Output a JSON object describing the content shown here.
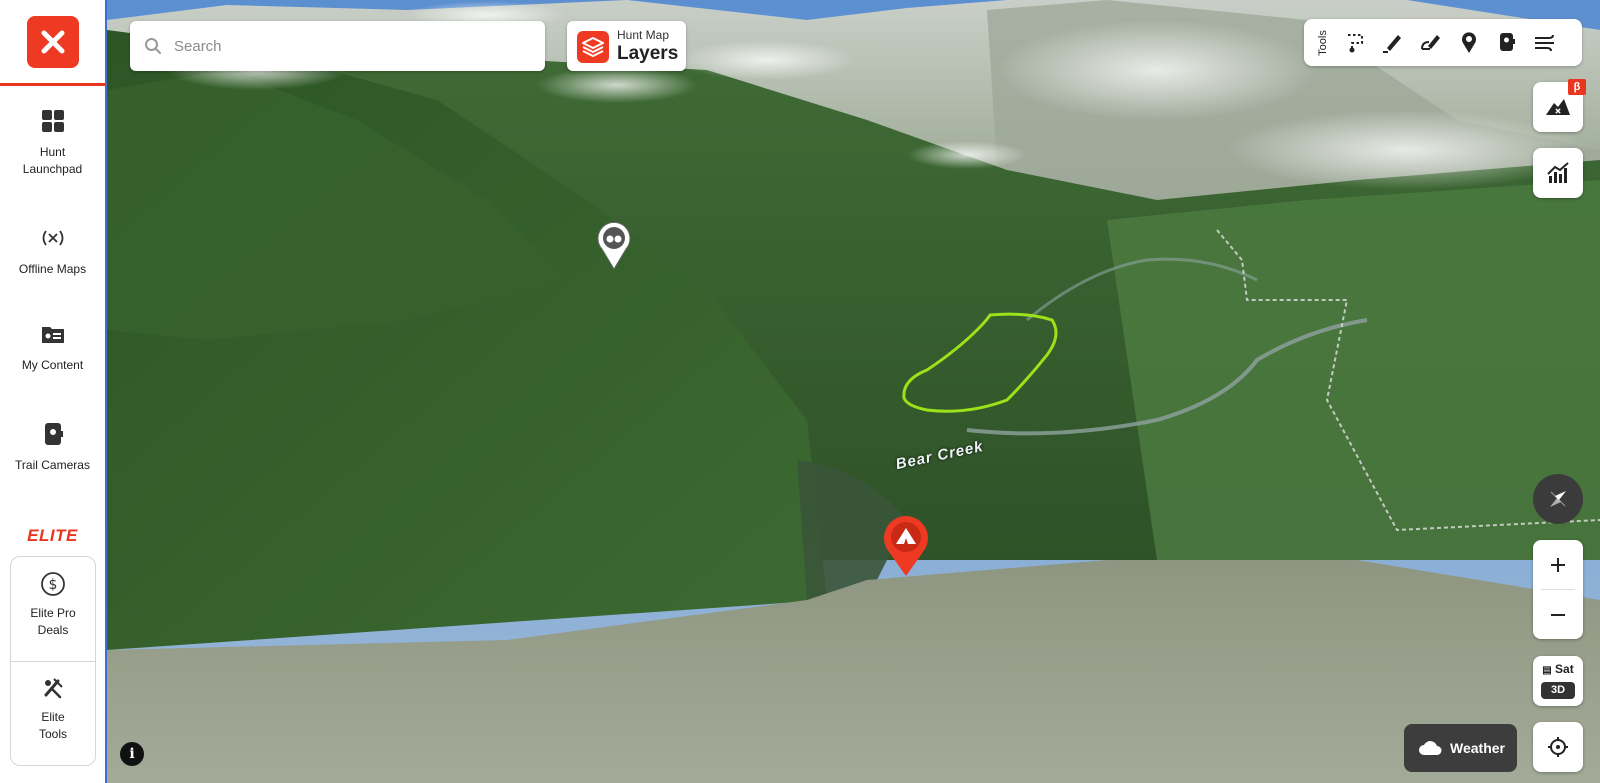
{
  "sidebar": {
    "close_icon": "close-x-icon",
    "items": [
      {
        "label_line1": "Hunt",
        "label_line2": "Launchpad",
        "icon": "grid-icon"
      },
      {
        "label": "Offline Maps",
        "icon": "broadcast-icon"
      },
      {
        "label": "My Content",
        "icon": "folder-card-icon"
      },
      {
        "label": "Trail Cameras",
        "icon": "trail-camera-icon"
      }
    ],
    "elite_label": "ELITE",
    "elite_items": [
      {
        "label_line1": "Elite Pro",
        "label_line2": "Deals",
        "icon": "dollar-circle-icon"
      },
      {
        "label_line1": "Elite",
        "label_line2": "Tools",
        "icon": "tools-icon"
      }
    ]
  },
  "search": {
    "placeholder": "Search"
  },
  "layers": {
    "subtitle": "Hunt Map",
    "title": "Layers"
  },
  "tools": {
    "label": "Tools"
  },
  "map": {
    "creek_label": "Bear Creek",
    "accent_color": "#ee3a22",
    "boundary_color": "#9be21a"
  },
  "controls": {
    "beta_badge": "β",
    "sat_label": "Sat",
    "view_mode": "3D",
    "weather_label": "Weather",
    "info_label": "i"
  }
}
